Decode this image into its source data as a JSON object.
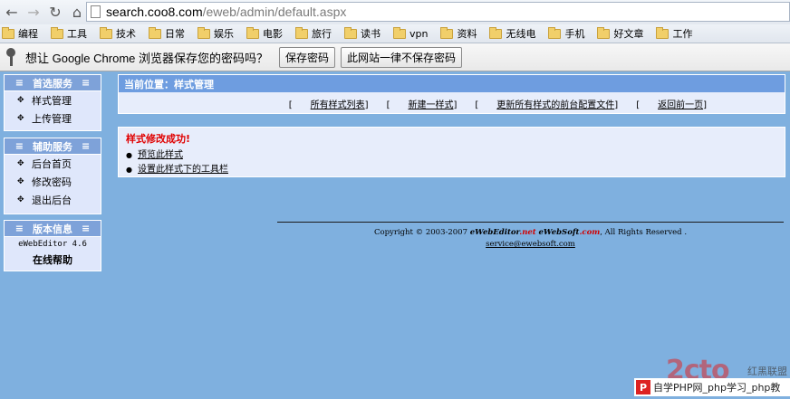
{
  "browser": {
    "url_host": "search.coo8.com",
    "url_path": "/eweb/admin/default.aspx"
  },
  "bookmarks": [
    "编程",
    "工具",
    "技术",
    "日常",
    "娱乐",
    "电影",
    "旅行",
    "读书",
    "vpn",
    "资料",
    "无线电",
    "手机",
    "好文章",
    "工作"
  ],
  "password_bar": {
    "message": "想让 Google Chrome 浏览器保存您的密码吗？",
    "save_label": "保存密码",
    "never_label": "此网站一律不保存密码"
  },
  "sidebar": {
    "section1": {
      "title": "首选服务",
      "items": [
        "样式管理",
        "上传管理"
      ]
    },
    "section2": {
      "title": "辅助服务",
      "items": [
        "后台首页",
        "修改密码",
        "退出后台"
      ]
    },
    "section3": {
      "title": "版本信息",
      "version": "eWebEditor 4.6",
      "help": "在线帮助"
    }
  },
  "location": {
    "label": "当前位置：样式管理",
    "links": [
      "所有样式列表",
      "新建一样式",
      "更新所有样式的前台配置文件",
      "返回前一页"
    ]
  },
  "message": {
    "title": "样式修改成功!",
    "links": [
      "预览此样式",
      "设置此样式下的工具栏"
    ]
  },
  "footer": {
    "copyright_prefix": "Copyright © 2003-2007 ",
    "brand1_a": "eWebEditor",
    "brand1_b": ".net",
    "brand2_a": "eWebSoft",
    "brand2_b": ".com",
    "copyright_suffix": ", All Rights Reserved .",
    "email": "service@ewebsoft.com"
  },
  "watermark": {
    "logo": "2cto",
    "cn": "红黑联盟",
    "bar_text": "自学PHP网_php学习_php教"
  }
}
